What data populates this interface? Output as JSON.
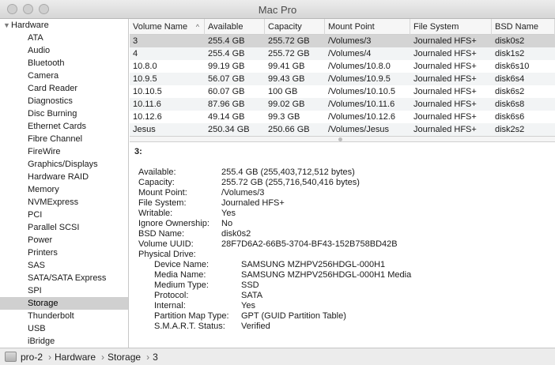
{
  "window": {
    "title": "Mac Pro"
  },
  "sidebar": {
    "header": "Hardware",
    "items": [
      "ATA",
      "Audio",
      "Bluetooth",
      "Camera",
      "Card Reader",
      "Diagnostics",
      "Disc Burning",
      "Ethernet Cards",
      "Fibre Channel",
      "FireWire",
      "Graphics/Displays",
      "Hardware RAID",
      "Memory",
      "NVMExpress",
      "PCI",
      "Parallel SCSI",
      "Power",
      "Printers",
      "SAS",
      "SATA/SATA Express",
      "SPI",
      "Storage",
      "Thunderbolt",
      "USB",
      "iBridge"
    ],
    "selected": "Storage"
  },
  "table": {
    "columns": [
      "Volume Name",
      "Available",
      "Capacity",
      "Mount Point",
      "File System",
      "BSD Name"
    ],
    "sorted_column": "Volume Name",
    "rows": [
      [
        "3",
        "255.4 GB",
        "255.72 GB",
        "/Volumes/3",
        "Journaled HFS+",
        "disk0s2"
      ],
      [
        "4",
        "255.4 GB",
        "255.72 GB",
        "/Volumes/4",
        "Journaled HFS+",
        "disk1s2"
      ],
      [
        "10.8.0",
        "99.19 GB",
        "99.41 GB",
        "/Volumes/10.8.0",
        "Journaled HFS+",
        "disk6s10"
      ],
      [
        "10.9.5",
        "56.07 GB",
        "99.43 GB",
        "/Volumes/10.9.5",
        "Journaled HFS+",
        "disk6s4"
      ],
      [
        "10.10.5",
        "60.07 GB",
        "100 GB",
        "/Volumes/10.10.5",
        "Journaled HFS+",
        "disk6s2"
      ],
      [
        "10.11.6",
        "87.96 GB",
        "99.02 GB",
        "/Volumes/10.11.6",
        "Journaled HFS+",
        "disk6s8"
      ],
      [
        "10.12.6",
        "49.14 GB",
        "99.3 GB",
        "/Volumes/10.12.6",
        "Journaled HFS+",
        "disk6s6"
      ],
      [
        "Jesus",
        "250.34 GB",
        "250.66 GB",
        "/Volumes/Jesus",
        "Journaled HFS+",
        "disk2s2"
      ]
    ],
    "selected_row": 0
  },
  "detail": {
    "title": "3:",
    "properties": [
      {
        "label": "Available:",
        "value": "255.4 GB (255,403,712,512 bytes)"
      },
      {
        "label": "Capacity:",
        "value": "255.72 GB (255,716,540,416 bytes)"
      },
      {
        "label": "Mount Point:",
        "value": "/Volumes/3"
      },
      {
        "label": "File System:",
        "value": "Journaled HFS+"
      },
      {
        "label": "Writable:",
        "value": "Yes"
      },
      {
        "label": "Ignore Ownership:",
        "value": "No"
      },
      {
        "label": "BSD Name:",
        "value": "disk0s2"
      },
      {
        "label": "Volume UUID:",
        "value": "28F7D6A2-66B5-3704-BF43-152B758BD42B"
      },
      {
        "label": "Physical Drive:",
        "value": ""
      }
    ],
    "physical_drive": [
      {
        "label": "Device Name:",
        "value": "SAMSUNG MZHPV256HDGL-000H1"
      },
      {
        "label": "Media Name:",
        "value": "SAMSUNG MZHPV256HDGL-000H1 Media"
      },
      {
        "label": "Medium Type:",
        "value": "SSD"
      },
      {
        "label": "Protocol:",
        "value": "SATA"
      },
      {
        "label": "Internal:",
        "value": "Yes"
      },
      {
        "label": "Partition Map Type:",
        "value": "GPT (GUID Partition Table)"
      },
      {
        "label": "S.M.A.R.T. Status:",
        "value": "Verified"
      }
    ]
  },
  "pathbar": {
    "icon": "drive-icon",
    "crumbs": [
      "pro-2",
      "Hardware",
      "Storage",
      "3"
    ]
  }
}
